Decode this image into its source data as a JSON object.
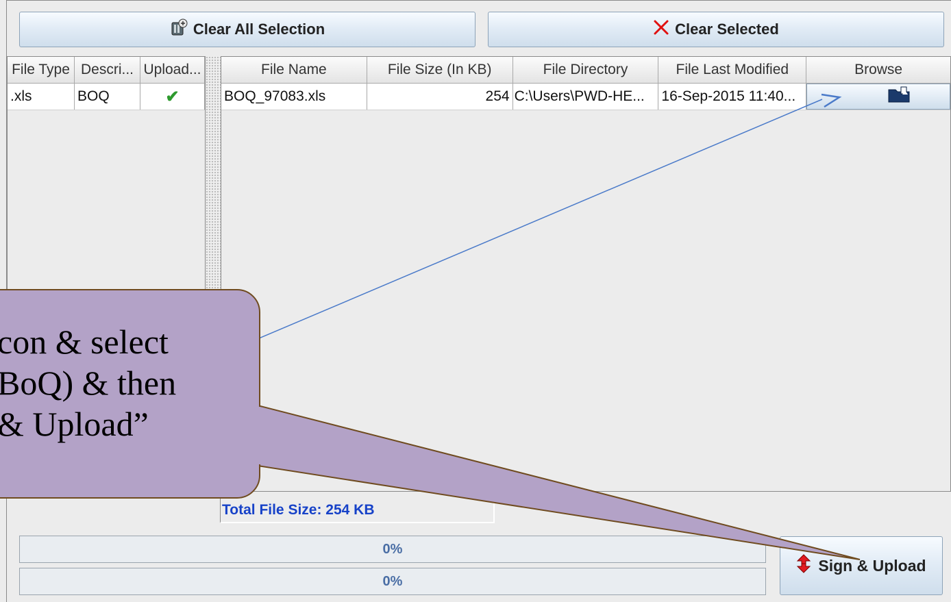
{
  "toolbar": {
    "clear_all_label": "Clear All Selection",
    "clear_selected_label": "Clear Selected"
  },
  "left_table": {
    "columns": [
      "File Type",
      "Descri...",
      "Upload..."
    ],
    "rows": [
      {
        "file_type": ".xls",
        "description": "BOQ",
        "uploaded": "✔"
      }
    ]
  },
  "right_table": {
    "columns": [
      "File Name",
      "File Size (In KB)",
      "File Directory",
      "File Last Modified",
      "Browse"
    ],
    "rows": [
      {
        "file_name": "BOQ_97083.xls",
        "file_size": "254",
        "file_directory": "C:\\Users\\PWD-HE...",
        "last_modified": "16-Sep-2015 11:40..."
      }
    ]
  },
  "total_size_label": "Total File Size: 254 KB",
  "progress": [
    {
      "label": "0%",
      "value": 0
    },
    {
      "label": "0%",
      "value": 0
    }
  ],
  "sign_upload_label": "Sign & Upload",
  "callout": {
    "lines": [
      "con & select",
      "BoQ) & then",
      "& Upload”"
    ]
  },
  "colors": {
    "callout_fill": "#b3a2c7",
    "total_text": "#1742c8",
    "progress_text": "#4a6ea5",
    "check": "#2e9a2e",
    "clear_x": "#e01010"
  }
}
